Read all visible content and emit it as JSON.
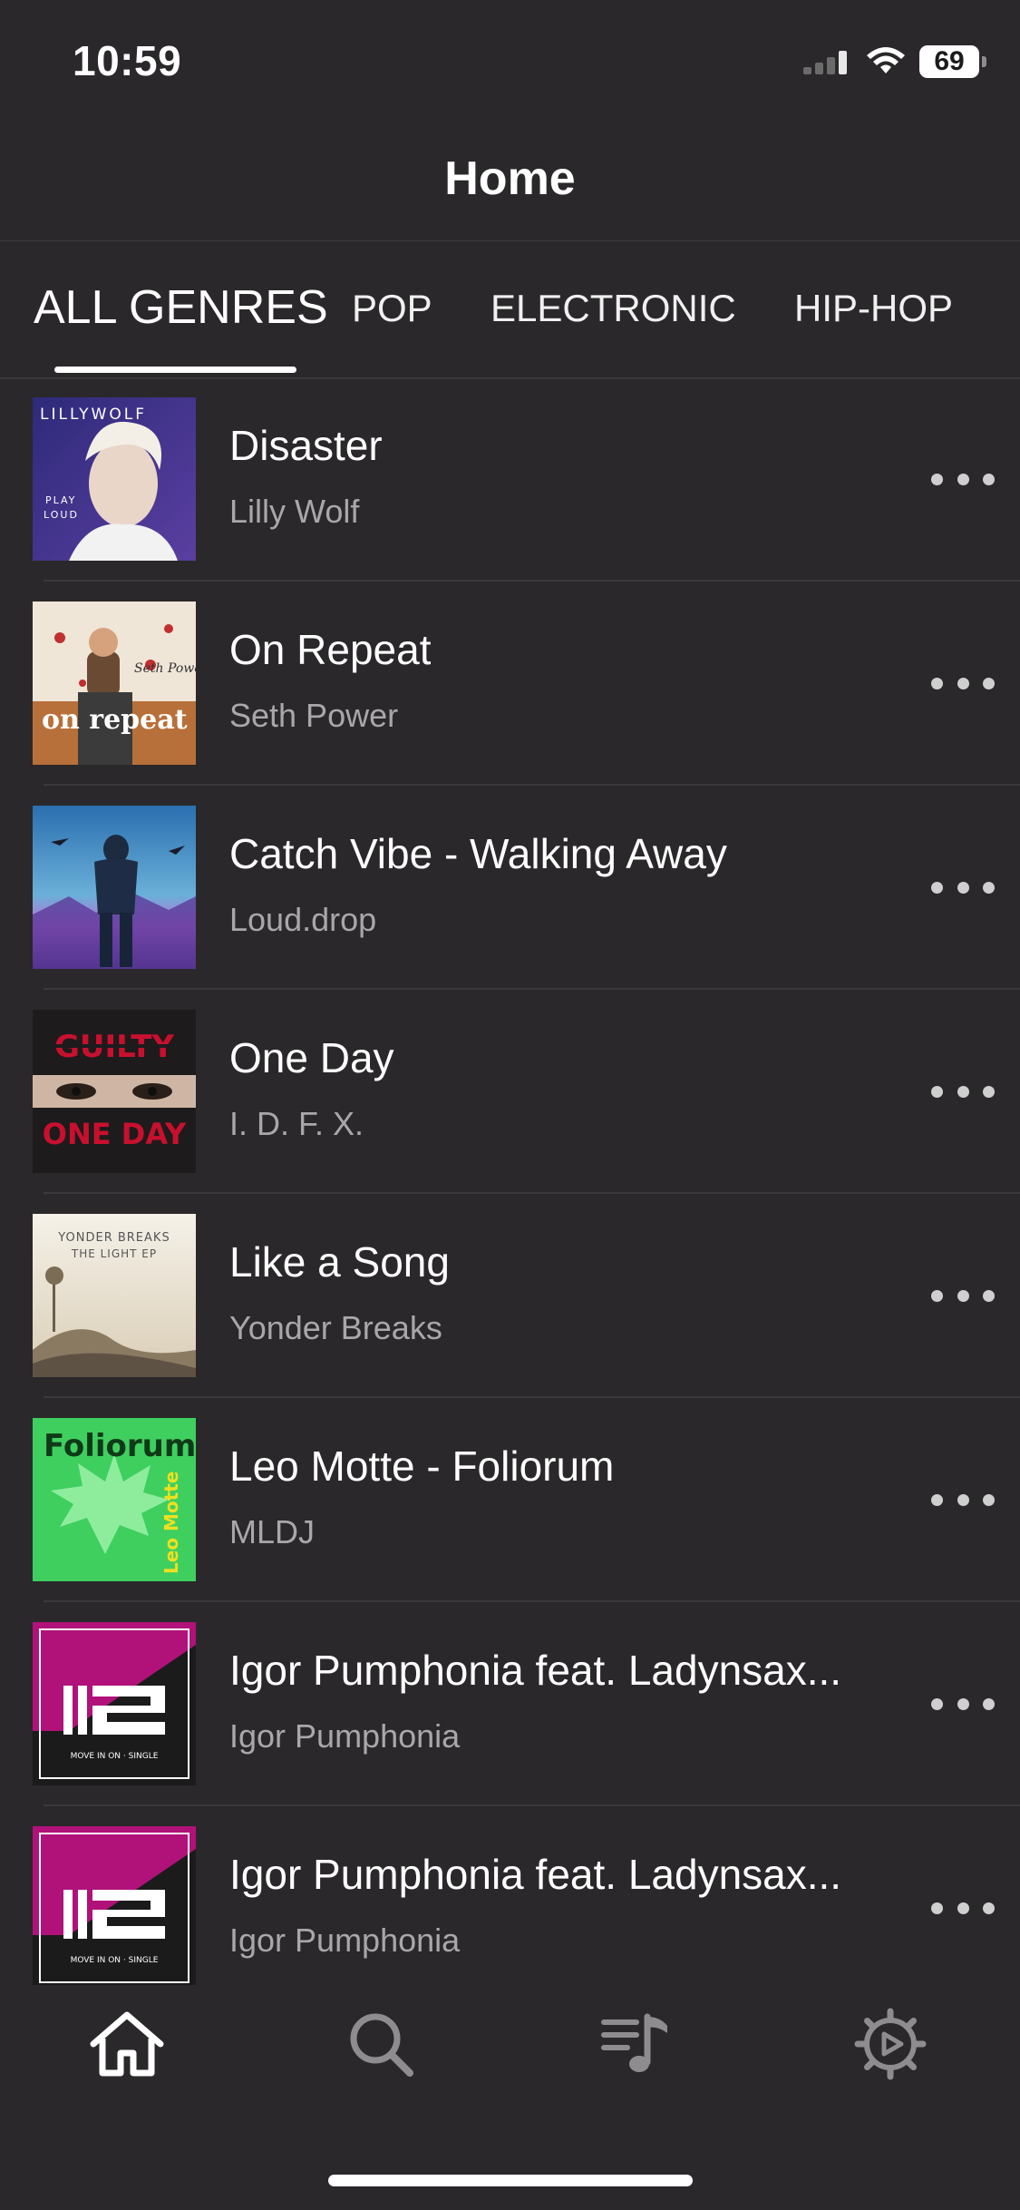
{
  "status_bar": {
    "time": "10:59",
    "battery": "69"
  },
  "nav": {
    "title": "Home"
  },
  "tabs": [
    {
      "label": "ALL GENRES",
      "active": true
    },
    {
      "label": "POP",
      "active": false
    },
    {
      "label": "ELECTRONIC",
      "active": false
    },
    {
      "label": "HIP-HOP",
      "active": false
    }
  ],
  "songs": [
    {
      "title": "Disaster",
      "artist": "Lilly Wolf",
      "art_text": [
        "LILLYWOLF",
        "PLAY",
        "LOUD"
      ]
    },
    {
      "title": "On Repeat",
      "artist": "Seth Power",
      "art_text": [
        "on repeat",
        "Seth Power"
      ]
    },
    {
      "title": "Catch Vibe - Walking Away",
      "artist": "Loud.drop",
      "art_text": []
    },
    {
      "title": "One Day",
      "artist": "I. D. F. X.",
      "art_text": [
        "GUILTY",
        "ONE DAY"
      ]
    },
    {
      "title": "Like a Song",
      "artist": "Yonder Breaks",
      "art_text": [
        "YONDER BREAKS",
        "THE LIGHT EP"
      ]
    },
    {
      "title": "Leo Motte - Foliorum",
      "artist": "MLDJ",
      "art_text": [
        "Foliorum",
        "Leo Motte"
      ]
    },
    {
      "title": "Igor Pumphonia feat. Ladynsax...",
      "artist": "Igor Pumphonia",
      "art_text": [
        "MOVE IN ON · SINGLE"
      ]
    },
    {
      "title": "Igor Pumphonia feat. Ladynsax...",
      "artist": "Igor Pumphonia",
      "art_text": [
        "MOVE IN ON · SINGLE"
      ]
    }
  ],
  "tab_bar": [
    {
      "icon": "home-icon",
      "active": true
    },
    {
      "icon": "search-icon",
      "active": false
    },
    {
      "icon": "playlist-icon",
      "active": false
    },
    {
      "icon": "settings-icon",
      "active": false
    }
  ],
  "colors": {
    "background": "#2a282a",
    "text": "#ffffff",
    "secondary_text": "#a9a7a9",
    "inactive_icon": "#8e8c8e"
  }
}
